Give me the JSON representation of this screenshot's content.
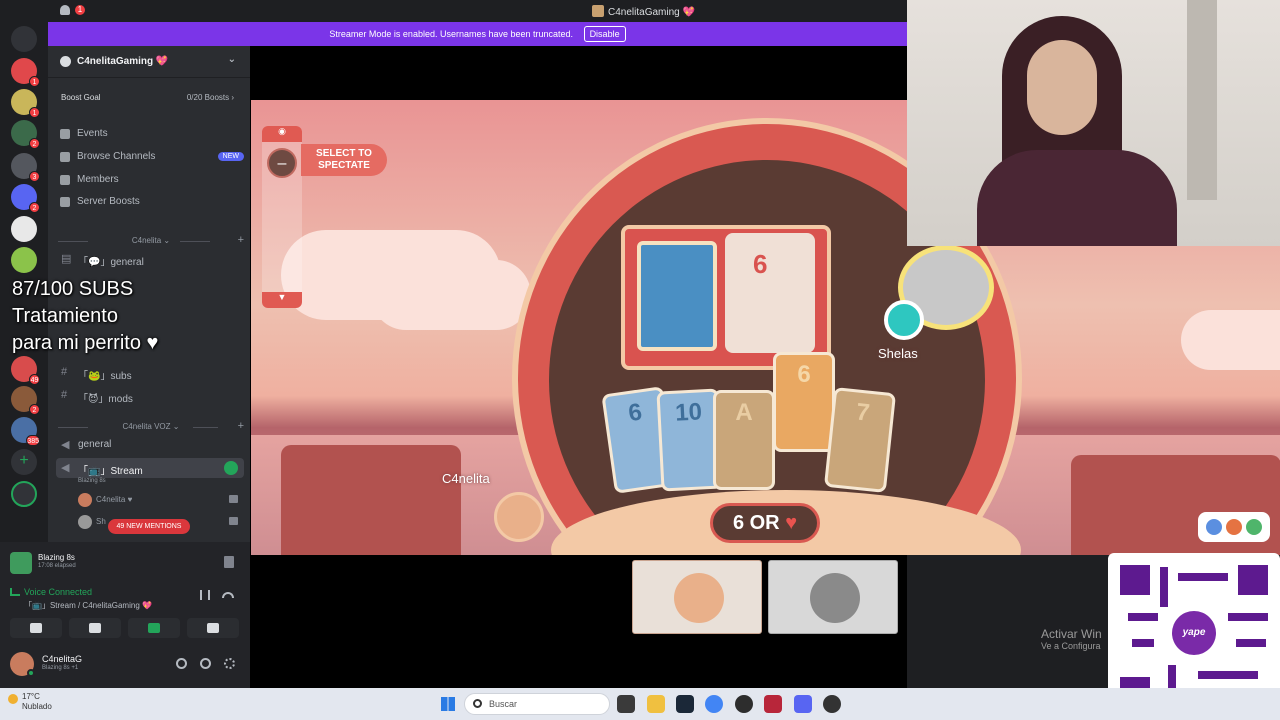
{
  "window": {
    "title": "C4nelitaGaming 💖",
    "notif_count": "1"
  },
  "streamer_bar": {
    "text": "Streamer Mode is enabled. Usernames have been truncated.",
    "disable_label": "Disable"
  },
  "servers": [
    {
      "icon": "discord-icon",
      "badge": ""
    },
    {
      "icon": "server-icon",
      "badge": "1"
    },
    {
      "icon": "server-icon",
      "badge": "1"
    },
    {
      "icon": "server-icon",
      "badge": "2"
    },
    {
      "icon": "server-icon",
      "badge": "3"
    },
    {
      "icon": "server-icon",
      "badge": "2"
    },
    {
      "icon": "server-icon",
      "badge": ""
    },
    {
      "icon": "server-icon",
      "badge": ""
    },
    {
      "icon": "server-icon",
      "badge": "49"
    },
    {
      "icon": "server-icon",
      "badge": "2"
    },
    {
      "icon": "server-icon",
      "badge": "385"
    }
  ],
  "guild": {
    "name": "C4nelitaGaming 💖"
  },
  "boost": {
    "label": "Boost Goal",
    "count": "0/20 Boosts ›"
  },
  "nav": {
    "events": "Events",
    "browse": "Browse Channels",
    "browse_badge": "NEW",
    "members": "Members",
    "boosts": "Server Boosts"
  },
  "categories": {
    "text": "C4nelita",
    "voice": "C4nelita VOZ"
  },
  "text_channels": {
    "general": "「💬」general",
    "subs": "「🐸」subs",
    "mods": "「😈」mods"
  },
  "voice_channels": {
    "general": "general",
    "stream": "「📺」Stream",
    "stream_activity": "Blazing 8s"
  },
  "stream_members": [
    "C4nelita ♥",
    "Sh"
  ],
  "mentions": "49 NEW MENTIONS",
  "overlay": {
    "line1": "87/100 SUBS",
    "line2": "Tratamiento",
    "line3": "para mi perrito ♥"
  },
  "activity": {
    "title": "Blazing 8s",
    "elapsed": "17:08 elapsed"
  },
  "voice": {
    "status": "Voice Connected",
    "channel": "「📺」Stream / C4nelitaGaming 💖"
  },
  "user": {
    "name": "C4nelitaG",
    "status": "Blazing 8s +1"
  },
  "game": {
    "spectate": "SELECT TO SPECTATE",
    "pile_number": "6",
    "hand": [
      "6",
      "10",
      "A",
      "6",
      "7"
    ],
    "prompt_prefix": "6 OR",
    "prompt_suffix": "♥",
    "player_self": "C4nelita",
    "player_opponent": "Shelas"
  },
  "activate": {
    "line1": "Activar Win",
    "line2": "Ve a Configura"
  },
  "qr_label": "yape",
  "taskbar": {
    "temp": "17°C",
    "weather": "Nublado",
    "search": "Buscar"
  },
  "colors": {
    "accent": "#7b35e8",
    "green": "#23a55a",
    "red": "#f23f43",
    "ring": "#d95951"
  }
}
